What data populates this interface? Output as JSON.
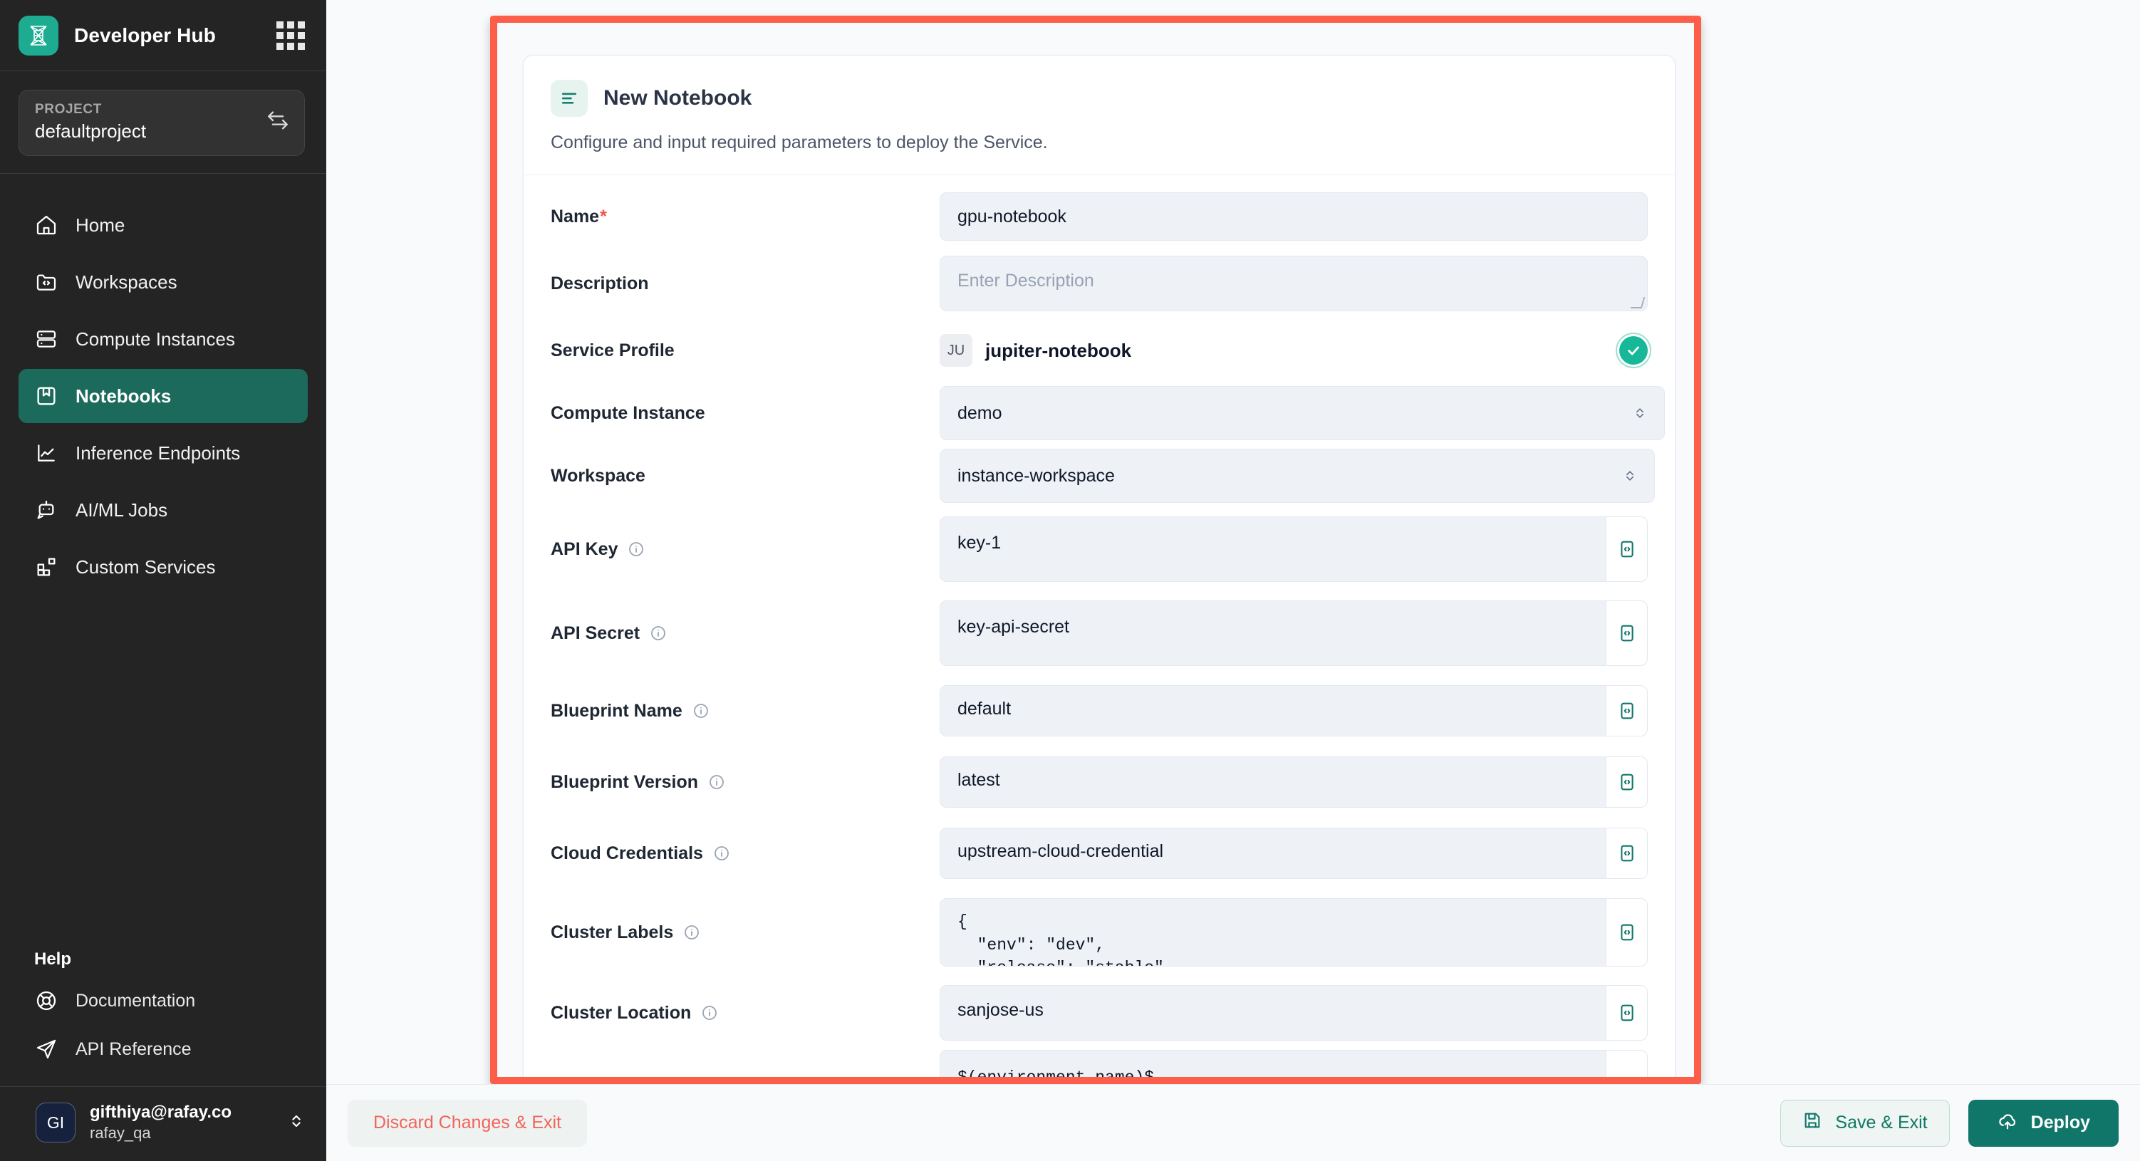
{
  "sidebar": {
    "brand": "Developer Hub",
    "logo_icon": "rafay-logo-icon",
    "apps_grid_icon": "apps-grid-icon",
    "project": {
      "label": "PROJECT",
      "value": "defaultproject",
      "switch_icon": "switch-project-icon"
    },
    "nav_items": [
      {
        "label": "Home",
        "icon": "home-icon",
        "active": false
      },
      {
        "label": "Workspaces",
        "icon": "folder-code-icon",
        "active": false
      },
      {
        "label": "Compute Instances",
        "icon": "server-icon",
        "active": false
      },
      {
        "label": "Notebooks",
        "icon": "notebook-icon",
        "active": true
      },
      {
        "label": "Inference Endpoints",
        "icon": "line-chart-icon",
        "active": false
      },
      {
        "label": "AI/ML Jobs",
        "icon": "bot-icon",
        "active": false
      },
      {
        "label": "Custom Services",
        "icon": "blocks-icon",
        "active": false
      }
    ],
    "help": {
      "title": "Help",
      "items": [
        {
          "label": "Documentation",
          "icon": "lifebuoy-icon"
        },
        {
          "label": "API Reference",
          "icon": "send-icon"
        }
      ]
    },
    "user": {
      "initials": "GI",
      "email": "gifthiya@rafay.co",
      "org": "rafay_qa",
      "caret_icon": "chevron-up-down-icon"
    }
  },
  "form": {
    "header_icon": "form-lines-icon",
    "title": "New Notebook",
    "subtitle": "Configure and input required parameters to deploy the Service.",
    "fields": {
      "name": {
        "label": "Name",
        "required_mark": "*",
        "value": "gpu-notebook"
      },
      "description": {
        "label": "Description",
        "value": "",
        "placeholder": "Enter Description"
      },
      "service_profile": {
        "label": "Service Profile",
        "badge": "JU",
        "value": "jupiter-notebook",
        "status_icon": "check-circle-icon"
      },
      "compute_instance": {
        "label": "Compute Instance",
        "value": "demo",
        "caret_icon": "chevron-up-down-icon"
      },
      "workspace": {
        "label": "Workspace",
        "value": "instance-workspace",
        "caret_icon": "chevron-up-down-icon"
      },
      "api_key": {
        "label": "API Key",
        "info_icon": "info-icon",
        "value": "key-1",
        "code_icon": "code-editor-icon"
      },
      "api_secret": {
        "label": "API Secret",
        "info_icon": "info-icon",
        "value": "key-api-secret",
        "code_icon": "code-editor-icon"
      },
      "blueprint_name": {
        "label": "Blueprint Name",
        "info_icon": "info-icon",
        "value": "default",
        "code_icon": "code-editor-icon"
      },
      "blueprint_version": {
        "label": "Blueprint Version",
        "info_icon": "info-icon",
        "value": "latest",
        "code_icon": "code-editor-icon"
      },
      "cloud_credentials": {
        "label": "Cloud Credentials",
        "info_icon": "info-icon",
        "value": "upstream-cloud-credential",
        "code_icon": "code-editor-icon"
      },
      "cluster_labels": {
        "label": "Cluster Labels",
        "info_icon": "info-icon",
        "value": "{\n  \"env\": \"dev\",\n  \"release\": \"stable\"",
        "code_icon": "code-editor-icon"
      },
      "cluster_location": {
        "label": "Cluster Location",
        "info_icon": "info-icon",
        "value": "sanjose-us",
        "code_icon": "code-editor-icon"
      },
      "partial_next": {
        "value": "$(environment.name)$"
      }
    }
  },
  "footer": {
    "discard_label": "Discard Changes & Exit",
    "save_label": "Save & Exit",
    "save_icon": "save-disk-icon",
    "deploy_label": "Deploy",
    "deploy_icon": "cloud-upload-icon"
  },
  "colors": {
    "accent_teal": "#11766a",
    "brand_green": "#1dab91",
    "highlight_red": "#fc5e4a",
    "sidebar_bg": "#242424",
    "danger_text": "#f2645a"
  }
}
